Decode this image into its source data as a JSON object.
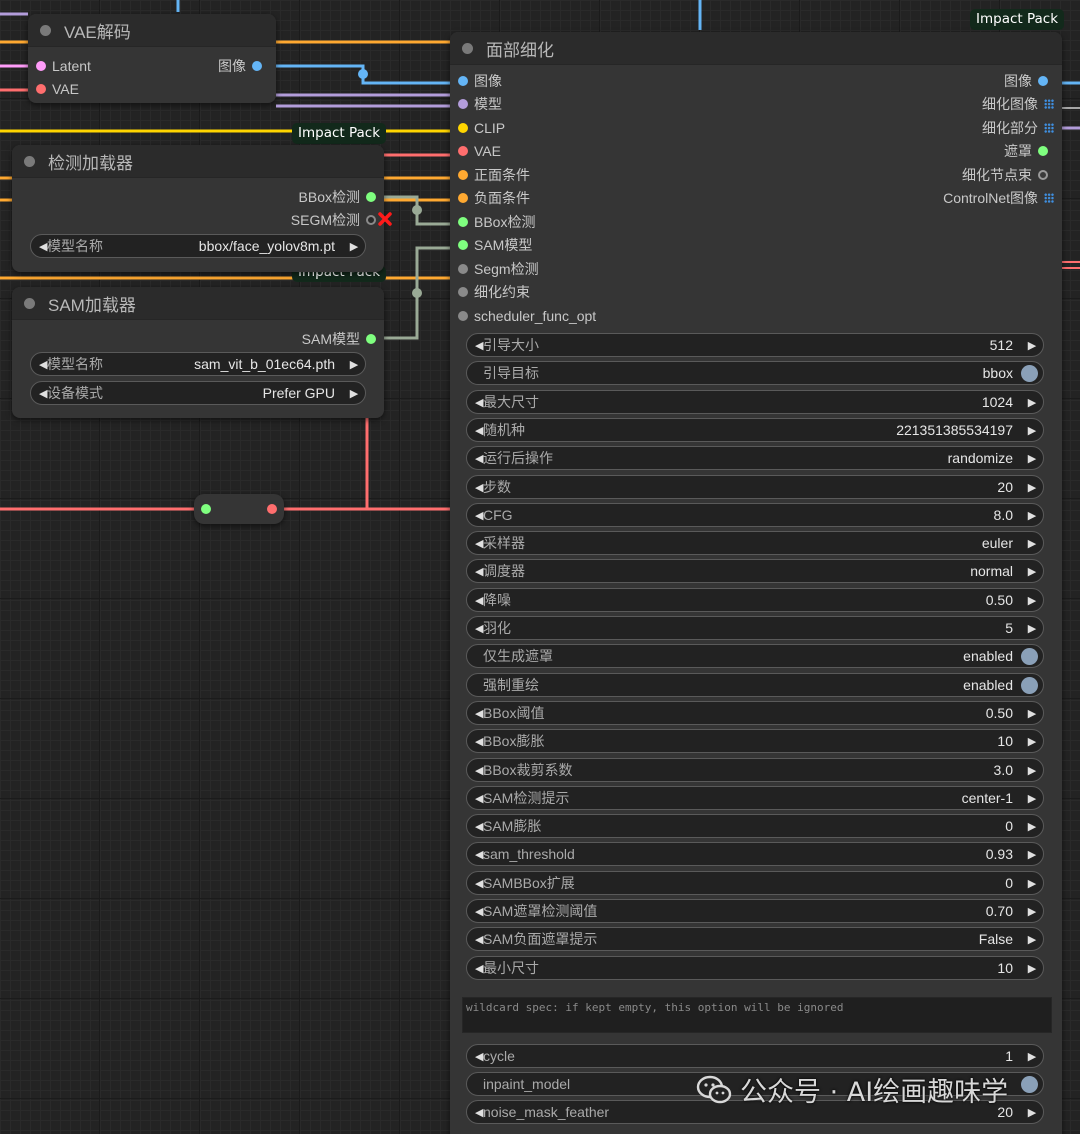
{
  "badges": {
    "impact_pack_1": "Impact Pack",
    "impact_pack_2": "Impact Pack",
    "impact_pack_3": "Impact Pack"
  },
  "vae_decode": {
    "title": "VAE解码",
    "inputs": [
      "Latent",
      "VAE"
    ],
    "output": "图像"
  },
  "detector_loader": {
    "title": "检测加载器",
    "outputs": [
      "BBox检测",
      "SEGM检测"
    ],
    "model_label": "模型名称",
    "model_value": "bbox/face_yolov8m.pt"
  },
  "sam_loader": {
    "title": "SAM加载器",
    "output": "SAM模型",
    "model_label": "模型名称",
    "model_value": "sam_vit_b_01ec64.pth",
    "device_label": "设备模式",
    "device_value": "Prefer GPU"
  },
  "face_detailer": {
    "title": "面部细化",
    "inputs": [
      "图像",
      "模型",
      "CLIP",
      "VAE",
      "正面条件",
      "负面条件",
      "BBox检测",
      "SAM模型",
      "Segm检测",
      "细化约束",
      "scheduler_func_opt"
    ],
    "outputs": [
      "图像",
      "细化图像",
      "细化部分",
      "遮罩",
      "细化节点束",
      "ControlNet图像"
    ],
    "widgets": [
      {
        "label": "引导大小",
        "value": "512",
        "kind": "number"
      },
      {
        "label": "引导目标",
        "value": "bbox",
        "kind": "toggle"
      },
      {
        "label": "最大尺寸",
        "value": "1024",
        "kind": "number"
      },
      {
        "label": "随机种",
        "value": "221351385534197",
        "kind": "number"
      },
      {
        "label": "运行后操作",
        "value": "randomize",
        "kind": "combo"
      },
      {
        "label": "步数",
        "value": "20",
        "kind": "number"
      },
      {
        "label": "CFG",
        "value": "8.0",
        "kind": "number"
      },
      {
        "label": "采样器",
        "value": "euler",
        "kind": "combo"
      },
      {
        "label": "调度器",
        "value": "normal",
        "kind": "combo"
      },
      {
        "label": "降噪",
        "value": "0.50",
        "kind": "number"
      },
      {
        "label": "羽化",
        "value": "5",
        "kind": "number"
      },
      {
        "label": "仅生成遮罩",
        "value": "enabled",
        "kind": "toggle"
      },
      {
        "label": "强制重绘",
        "value": "enabled",
        "kind": "toggle"
      },
      {
        "label": "BBox阈值",
        "value": "0.50",
        "kind": "number"
      },
      {
        "label": "BBox膨胀",
        "value": "10",
        "kind": "number"
      },
      {
        "label": "BBox裁剪系数",
        "value": "3.0",
        "kind": "number"
      },
      {
        "label": "SAM检测提示",
        "value": "center-1",
        "kind": "combo"
      },
      {
        "label": "SAM膨胀",
        "value": "0",
        "kind": "number"
      },
      {
        "label": "sam_threshold",
        "value": "0.93",
        "kind": "number"
      },
      {
        "label": "SAMBBox扩展",
        "value": "0",
        "kind": "number"
      },
      {
        "label": "SAM遮罩检测阈值",
        "value": "0.70",
        "kind": "number"
      },
      {
        "label": "SAM负面遮罩提示",
        "value": "False",
        "kind": "combo"
      },
      {
        "label": "最小尺寸",
        "value": "10",
        "kind": "number"
      }
    ],
    "wildcard_placeholder": "wildcard spec: if kept empty, this option will be ignored",
    "widgets_after": [
      {
        "label": "cycle",
        "value": "1",
        "kind": "number"
      },
      {
        "label": "inpaint_model",
        "value": "",
        "kind": "toggle"
      },
      {
        "label": "noise_mask_feather",
        "value": "20",
        "kind": "number"
      }
    ]
  },
  "watermark": {
    "text": "公众号 · AI绘画趣味学"
  },
  "colors": {
    "image": "#64b5f6",
    "latent": "#ff9cf9",
    "vae": "#ff6e6e",
    "model": "#b39ddb",
    "clip": "#ffd500",
    "conditioning": "#ffa931",
    "bbox": "#7fff7f",
    "sam": "#7fff7f",
    "gray": "#8a8a8a",
    "node_bg": "#353535",
    "title_bg": "#2b2b2b"
  }
}
